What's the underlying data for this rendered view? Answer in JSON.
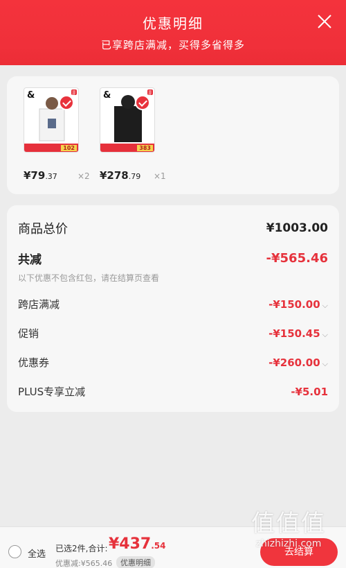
{
  "header": {
    "title": "优惠明细",
    "subtitle": "已享跨店满减，买得多省得多"
  },
  "products": [
    {
      "brand": "&",
      "tag": "JJ",
      "price_main": "¥79",
      "price_dec": ".37",
      "qty": "×2",
      "badge": "102"
    },
    {
      "brand": "&",
      "tag": "JJ",
      "price_main": "¥278",
      "price_dec": ".79",
      "qty": "×1",
      "badge": "383"
    }
  ],
  "summary": {
    "total_label": "商品总价",
    "total_value": "¥1003.00",
    "minus_label": "共减",
    "minus_value": "-¥565.46",
    "note": "以下优惠不包含红包，请在结算页查看",
    "items": [
      {
        "label": "跨店满减",
        "value": "-¥150.00"
      },
      {
        "label": "促销",
        "value": "-¥150.45"
      },
      {
        "label": "优惠券",
        "value": "-¥260.00"
      },
      {
        "label": "PLUS专享立减",
        "value": "-¥5.01"
      }
    ]
  },
  "bottom": {
    "select_all": "全选",
    "selected_text": "已选2件,合计:",
    "price_main": "¥437",
    "price_dec": ".54",
    "saved": "优惠减:¥565.46",
    "detail_btn": "优惠明细",
    "checkout": "去结算"
  },
  "watermark": {
    "logo": "值值值",
    "text": "zhizhizhi.com"
  },
  "colors": {
    "brand_red": "#f0303a",
    "price_red": "#e6323c"
  }
}
